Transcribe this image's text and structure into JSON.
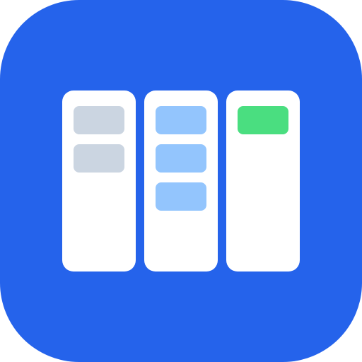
{
  "icon": {
    "name": "kanban-board-icon",
    "background_color": "#2563eb",
    "column_color": "#ffffff",
    "columns": [
      {
        "cards": [
          {
            "color": "#cbd5e1"
          },
          {
            "color": "#cbd5e1"
          }
        ]
      },
      {
        "cards": [
          {
            "color": "#93c5fd"
          },
          {
            "color": "#93c5fd"
          },
          {
            "color": "#93c5fd"
          }
        ]
      },
      {
        "cards": [
          {
            "color": "#4ade80"
          }
        ]
      }
    ]
  }
}
